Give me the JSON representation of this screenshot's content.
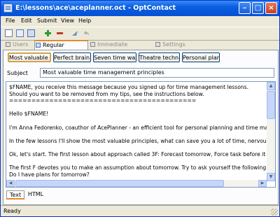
{
  "window": {
    "title": "E:\\lessons\\ace\\aceplanner.oct - OptContact",
    "minimize_glyph": "–",
    "maximize_glyph": "□",
    "close_glyph": "×"
  },
  "menu": {
    "items": [
      "File",
      "Edit",
      "Submit",
      "View",
      "Help"
    ]
  },
  "toolbar": {
    "icons": [
      "new-document-icon",
      "open-icon",
      "save-icon",
      "add-icon",
      "remove-icon",
      "send-icon",
      "undo-icon"
    ]
  },
  "tabs": [
    {
      "label": "Users",
      "icon": "users-icon",
      "active": false
    },
    {
      "label": "Regular messages",
      "icon": "messages-icon",
      "active": true
    },
    {
      "label": "Immediate messages",
      "icon": "immediate-messages-icon",
      "active": false
    },
    {
      "label": "Settings",
      "icon": "settings-icon",
      "active": false
    }
  ],
  "templates": [
    {
      "label": "Most valuable t",
      "selected": true
    },
    {
      "label": "Perfect brain f",
      "selected": false
    },
    {
      "label": "Seven time wast",
      "selected": false
    },
    {
      "label": "Theatre techniq",
      "selected": false
    },
    {
      "label": "Personal planni",
      "selected": false
    }
  ],
  "subject": {
    "label": "Subject",
    "value": "Most valuable time management principles"
  },
  "body_lines": [
    "$FNAME, you receive this message because you signed up for time management lessons.",
    "Should you want to be removed from my tips, see the instructions below.",
    "==========================================",
    "",
    "Hello $FNAME!",
    "",
    "I'm Anna Fedorenko, coauthor of AcePlanner - an efficient tool for personal planning and time manageme",
    "",
    "In the few lessons I'll show the most valuable principles, what can save you a lot of time, nervous and effor",
    "",
    "Ok, let's start. The first lesson about approach called 3F: Forecast tomorrow, Force task before it forces yo",
    "",
    "The first F devotes you to make an assumption about tomorrow. Try to ask yourself the following question",
    "Do I have plans for tomorrow?"
  ],
  "body_tabs": [
    "Text",
    "HTML"
  ],
  "status": "Ready"
}
